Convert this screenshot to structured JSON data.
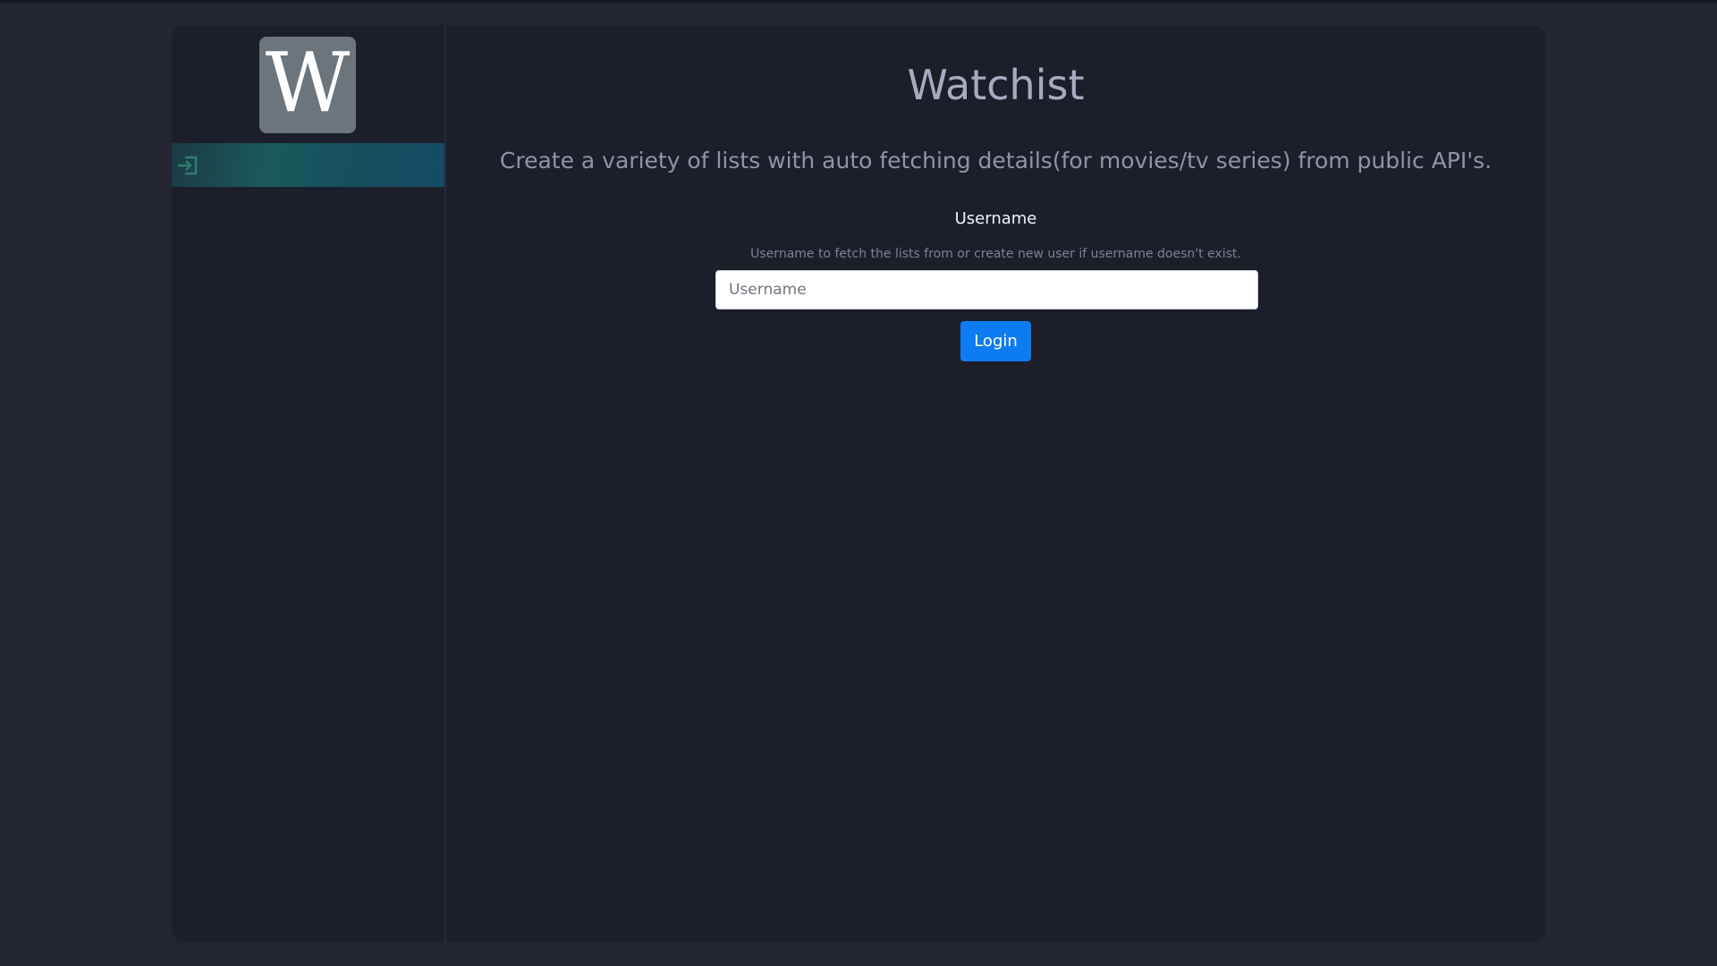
{
  "app": {
    "logo_letter": "W",
    "title": "Watchist",
    "subtitle": "Create a variety of lists with auto fetching details(for movies/tv series) from public API's."
  },
  "sidebar": {
    "items": [
      {
        "icon": "login-icon",
        "label": ""
      }
    ]
  },
  "form": {
    "username_label": "Username",
    "username_help": "Username to fetch the lists from or create new user if username doesn't exist.",
    "username_placeholder": "Username",
    "username_value": "",
    "login_label": "Login"
  },
  "colors": {
    "accent": "#0d7cf2",
    "background": "#232631",
    "panel": "#1c1f2a",
    "logo_bg": "#6c747c"
  }
}
